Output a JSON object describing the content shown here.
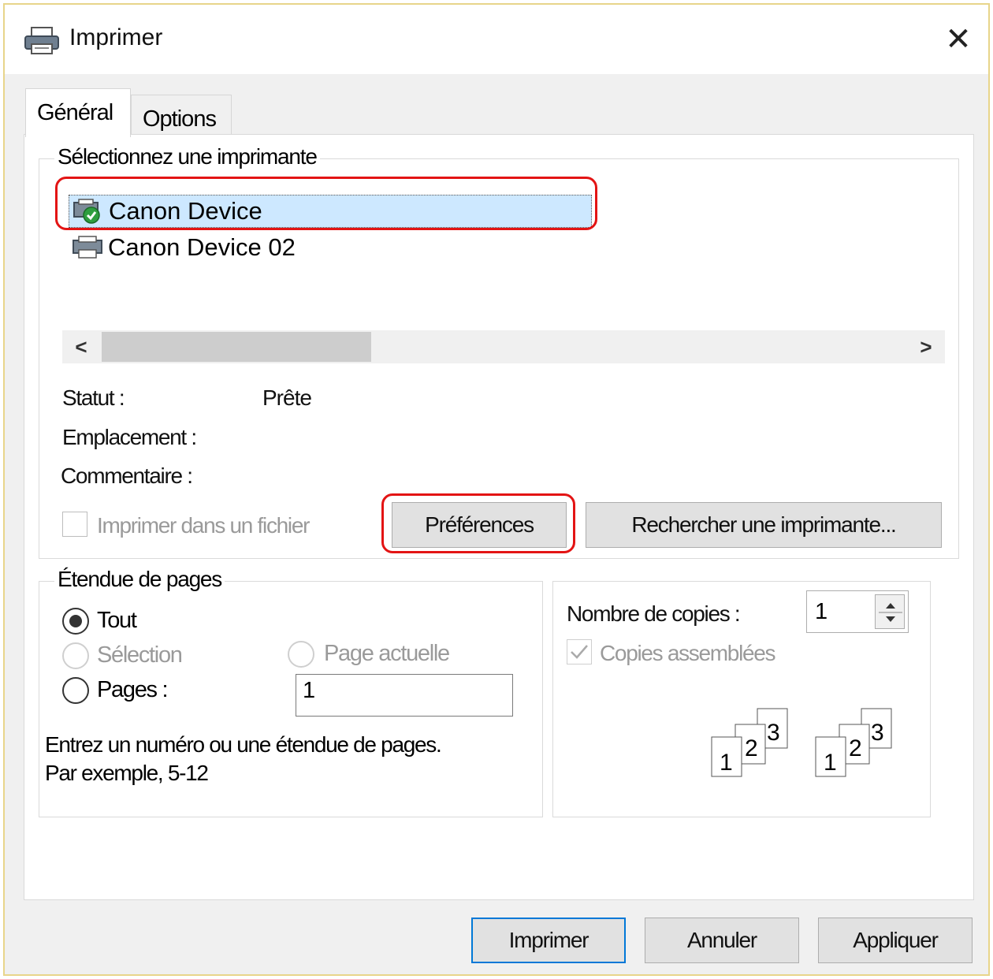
{
  "window": {
    "title": "Imprimer",
    "close_glyph": "✕"
  },
  "tabs": [
    {
      "label": "Général",
      "active": true
    },
    {
      "label": "Options",
      "active": false
    }
  ],
  "printer_group": {
    "legend": "Sélectionnez une imprimante",
    "printers": [
      {
        "name": "Canon Device",
        "selected": true,
        "icon": "printer-default-icon"
      },
      {
        "name": "Canon Device 02",
        "selected": false,
        "icon": "printer-icon"
      }
    ],
    "scroll_left": "<",
    "scroll_right": ">",
    "status_label": "Statut :",
    "status_value": "Prête",
    "location_label": "Emplacement :",
    "comment_label": "Commentaire :",
    "print_to_file_label": "Imprimer dans un fichier",
    "preferences_button": "Préférences",
    "find_printer_button": "Rechercher une imprimante..."
  },
  "page_range": {
    "legend": "Étendue de pages",
    "all_label": "Tout",
    "selection_label": "Sélection",
    "current_page_label": "Page actuelle",
    "pages_label": "Pages :",
    "pages_value": "1",
    "hint_line1": "Entrez un numéro ou une étendue de pages.",
    "hint_line2": "Par exemple, 5-12"
  },
  "copies": {
    "count_label": "Nombre de copies :",
    "count_value": "1",
    "collate_label": "Copies assemblées",
    "collate_icon": "collate-pages-icon",
    "pages": [
      "1",
      "2",
      "3"
    ]
  },
  "buttons": {
    "print": "Imprimer",
    "cancel": "Annuler",
    "apply": "Appliquer"
  },
  "colors": {
    "highlight": "#e31414",
    "selection": "#cde8ff",
    "primary_border": "#0078d7"
  }
}
